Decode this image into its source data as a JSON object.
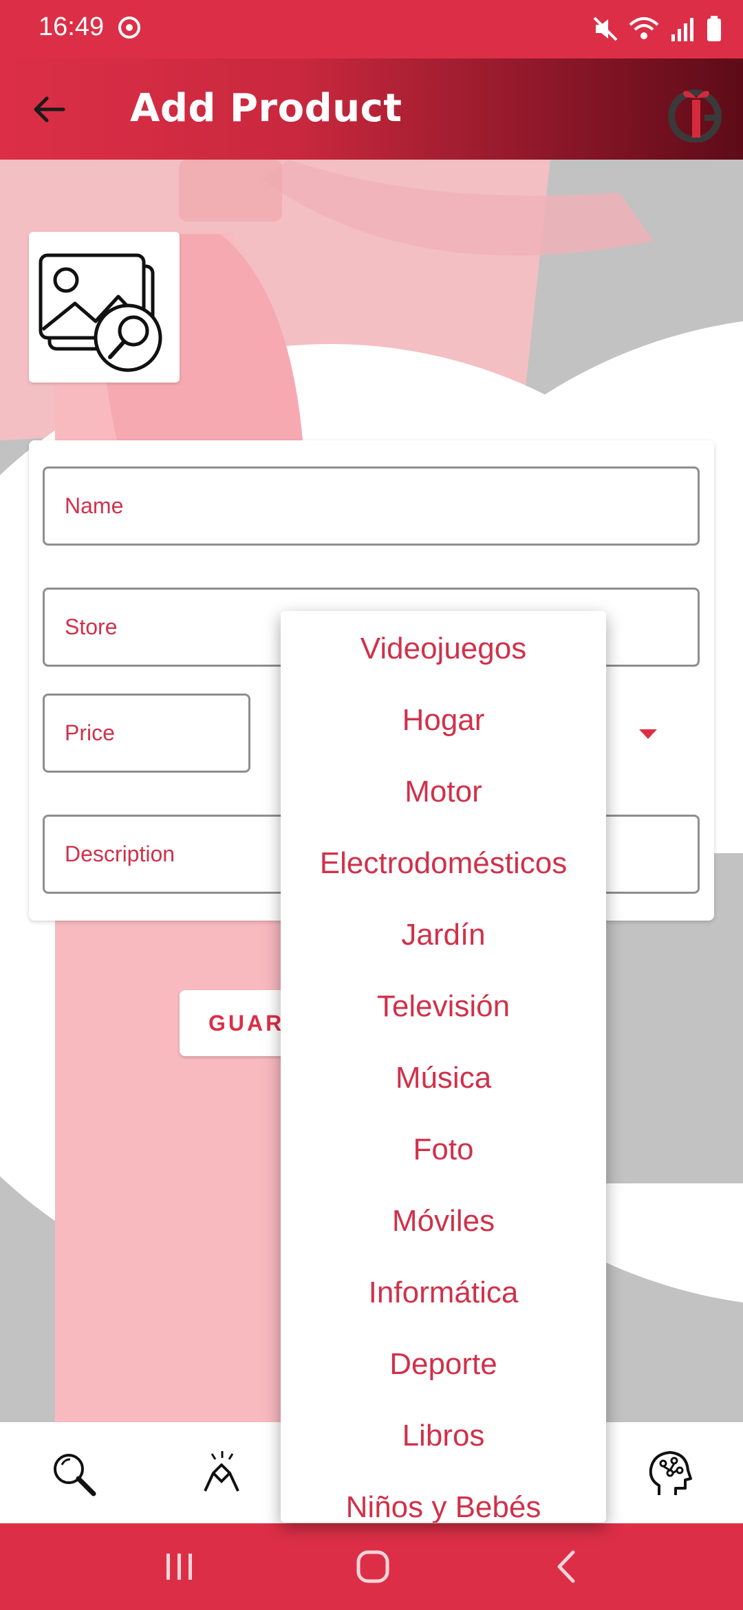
{
  "status_bar": {
    "time": "16:49"
  },
  "app_bar": {
    "title": "Add Product"
  },
  "form": {
    "name_placeholder": "Name",
    "store_placeholder": "Store",
    "price_placeholder": "Price",
    "description_placeholder": "Description"
  },
  "save_button": {
    "label": "GUAR"
  },
  "dropdown": {
    "items": [
      "Videojuegos",
      "Hogar",
      "Motor",
      "Electrodomésticos",
      "Jardín",
      "Televisión",
      "Música",
      "Foto",
      "Móviles",
      "Informática",
      "Deporte",
      "Libros",
      "Niños y Bebés"
    ]
  },
  "bottom_nav": {
    "icons": [
      "search-icon",
      "handshake-icon",
      "brain-head-icon"
    ]
  },
  "colors": {
    "accent": "#dc2f47",
    "dark_accent": "#5e0b18",
    "text_red": "#d0314a"
  }
}
